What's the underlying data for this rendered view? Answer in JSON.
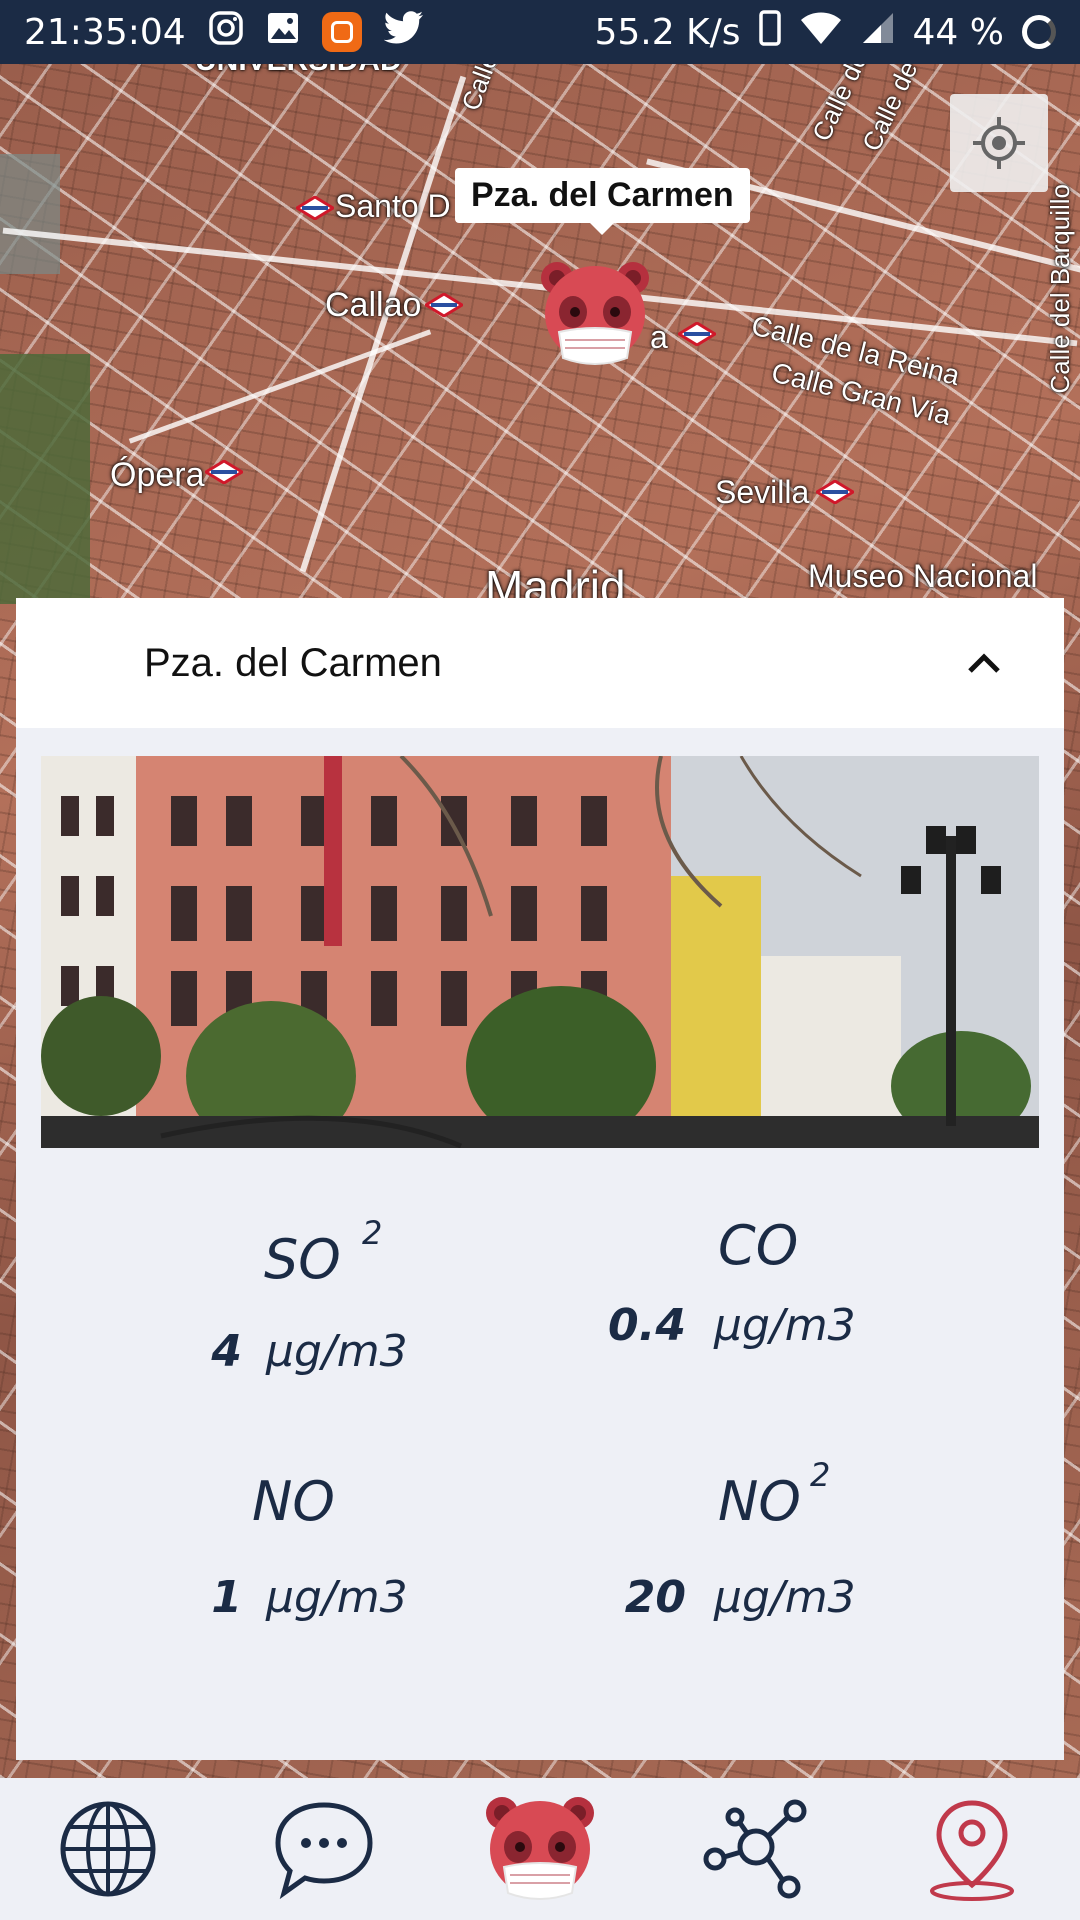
{
  "status_bar": {
    "time": "21:35:04",
    "network_speed": "55.2 K/s",
    "battery": "44 %",
    "icons": [
      "instagram-icon",
      "gallery-icon",
      "mi-app-icon",
      "twitter-icon",
      "phone-icon",
      "wifi-icon",
      "signal-icon",
      "battery-icon"
    ]
  },
  "map": {
    "labels": {
      "universidad": "UNIVERSIDAD",
      "santo_domingo": "Santo D",
      "callao": "Callao",
      "opera": "Ópera",
      "gran_via": "a",
      "calle_reina": "Calle de la Reina",
      "calle_gran_via": "Calle Gran Vía",
      "sevilla": "Sevilla",
      "madrid": "Madrid",
      "museo": "Museo Nacional",
      "calle_barquillo": "Calle del Barquillo",
      "calle_1": "Calle",
      "calle_2": "Calle de",
      "calle_3": "Calle de"
    },
    "marker_callout": "Pza. del Carmen"
  },
  "station": {
    "name": "Pza. del Carmen",
    "metrics": [
      {
        "name": "SO",
        "sub": "2",
        "value": "4",
        "unit": "μg/m3"
      },
      {
        "name": "CO",
        "sub": "",
        "value": "0.4",
        "unit": "μg/m3"
      },
      {
        "name": "NO",
        "sub": "",
        "value": "1",
        "unit": "μg/m3"
      },
      {
        "name": "NO",
        "sub": "2",
        "value": "20",
        "unit": "μg/m3"
      }
    ]
  },
  "bottom_nav": {
    "items": [
      "globe-icon",
      "chat-icon",
      "bear-mascot-icon",
      "network-icon",
      "location-pin-icon"
    ],
    "active_color": "#c0394b"
  },
  "colors": {
    "primary": "#1b2b45",
    "accent": "#c0394b",
    "panel_bg": "#eef0f6"
  }
}
